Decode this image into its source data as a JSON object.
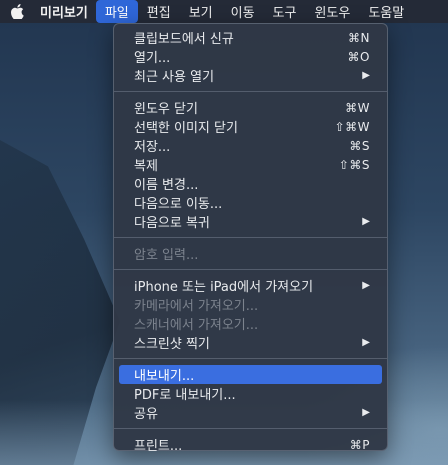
{
  "menubar": {
    "apple_icon": "apple-logo-icon",
    "items": [
      {
        "label": "미리보기"
      },
      {
        "label": "파일"
      },
      {
        "label": "편집"
      },
      {
        "label": "보기"
      },
      {
        "label": "이동"
      },
      {
        "label": "도구"
      },
      {
        "label": "윈도우"
      },
      {
        "label": "도움말"
      }
    ],
    "active_index": 1
  },
  "file_menu": {
    "groups": [
      [
        {
          "label": "클립보드에서 신규",
          "shortcut": "⌘N"
        },
        {
          "label": "열기...",
          "shortcut": "⌘O"
        },
        {
          "label": "최근 사용 열기",
          "submenu_arrow": "▶"
        }
      ],
      [
        {
          "label": "윈도우 닫기",
          "shortcut": "⌘W"
        },
        {
          "label": "선택한 이미지 닫기",
          "shortcut": "⇧⌘W"
        },
        {
          "label": "저장...",
          "shortcut": "⌘S"
        },
        {
          "label": "복제",
          "shortcut": "⇧⌘S"
        },
        {
          "label": "이름 변경..."
        },
        {
          "label": "다음으로 이동..."
        },
        {
          "label": "다음으로 복귀",
          "submenu_arrow": "▶"
        }
      ],
      [
        {
          "label": "암호 입력...",
          "disabled": true
        }
      ],
      [
        {
          "label": "iPhone 또는 iPad에서 가져오기",
          "submenu_arrow": "▶"
        },
        {
          "label": "카메라에서 가져오기...",
          "disabled": true
        },
        {
          "label": "스캐너에서 가져오기...",
          "disabled": true
        },
        {
          "label": "스크린샷 찍기",
          "submenu_arrow": "▶"
        }
      ],
      [
        {
          "label": "내보내기...",
          "highlighted": true
        },
        {
          "label": "PDF로 내보내기..."
        },
        {
          "label": "공유",
          "submenu_arrow": "▶"
        }
      ],
      [
        {
          "label": "프린트...",
          "shortcut": "⌘P"
        }
      ]
    ]
  },
  "colors": {
    "highlight": "#3a6ee0",
    "menubar_active": "#2f67d8",
    "menu_background": "#303846"
  }
}
